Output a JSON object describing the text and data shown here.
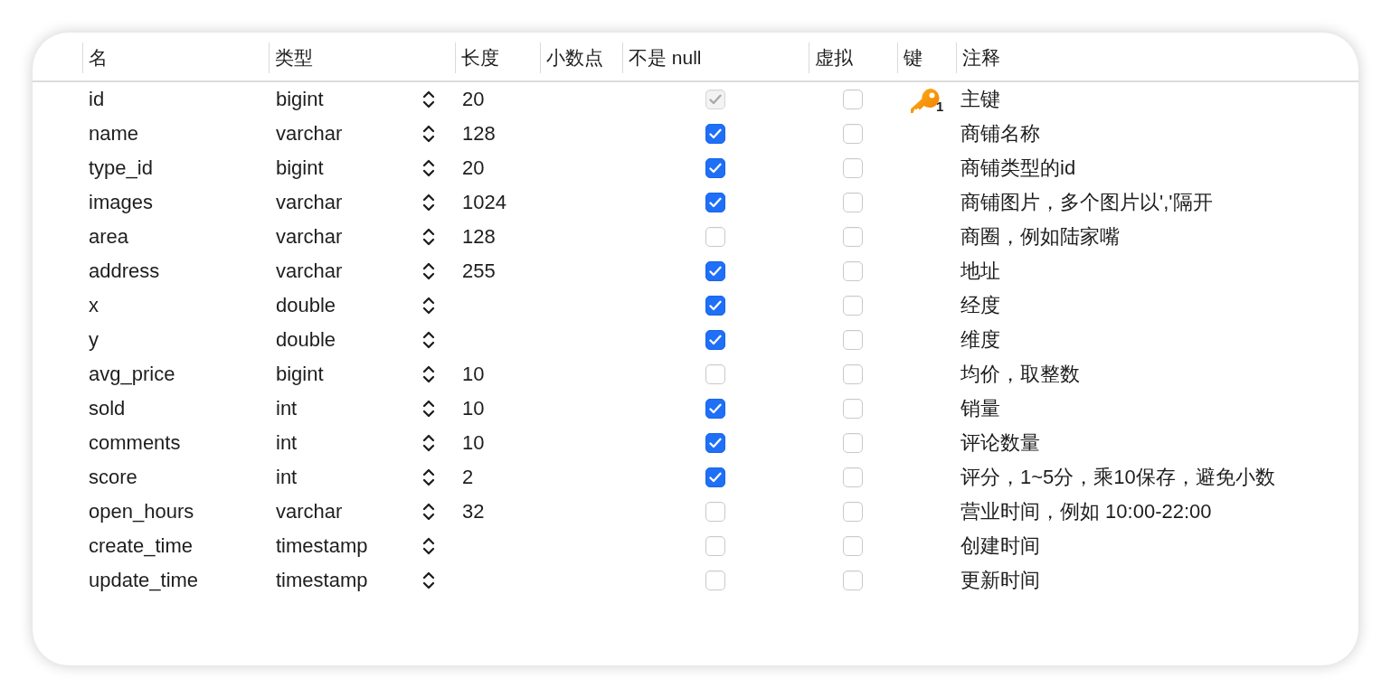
{
  "columns": [
    "名",
    "类型",
    "长度",
    "小数点",
    "不是 null",
    "虚拟",
    "键",
    "注释"
  ],
  "rows": [
    {
      "name": "id",
      "type": "bigint",
      "length": "20",
      "not_null": true,
      "not_null_disabled": true,
      "virtual": false,
      "primary_key": true,
      "key_order": "1",
      "comment": "主键"
    },
    {
      "name": "name",
      "type": "varchar",
      "length": "128",
      "not_null": true,
      "not_null_disabled": false,
      "virtual": false,
      "primary_key": false,
      "comment": "商铺名称"
    },
    {
      "name": "type_id",
      "type": "bigint",
      "length": "20",
      "not_null": true,
      "not_null_disabled": false,
      "virtual": false,
      "primary_key": false,
      "comment": "商铺类型的id"
    },
    {
      "name": "images",
      "type": "varchar",
      "length": "1024",
      "not_null": true,
      "not_null_disabled": false,
      "virtual": false,
      "primary_key": false,
      "comment": "商铺图片，多个图片以','隔开"
    },
    {
      "name": "area",
      "type": "varchar",
      "length": "128",
      "not_null": false,
      "not_null_disabled": false,
      "virtual": false,
      "primary_key": false,
      "comment": "商圈，例如陆家嘴"
    },
    {
      "name": "address",
      "type": "varchar",
      "length": "255",
      "not_null": true,
      "not_null_disabled": false,
      "virtual": false,
      "primary_key": false,
      "comment": "地址"
    },
    {
      "name": "x",
      "type": "double",
      "not_null": true,
      "not_null_disabled": false,
      "virtual": false,
      "primary_key": false,
      "comment": "经度"
    },
    {
      "name": "y",
      "type": "double",
      "not_null": true,
      "not_null_disabled": false,
      "virtual": false,
      "primary_key": false,
      "comment": "维度"
    },
    {
      "name": "avg_price",
      "type": "bigint",
      "length": "10",
      "not_null": false,
      "not_null_disabled": false,
      "virtual": false,
      "primary_key": false,
      "comment": "均价，取整数"
    },
    {
      "name": "sold",
      "type": "int",
      "length": "10",
      "not_null": true,
      "not_null_disabled": false,
      "virtual": false,
      "primary_key": false,
      "comment": "销量"
    },
    {
      "name": "comments",
      "type": "int",
      "length": "10",
      "not_null": true,
      "not_null_disabled": false,
      "virtual": false,
      "primary_key": false,
      "comment": "评论数量"
    },
    {
      "name": "score",
      "type": "int",
      "length": "2",
      "not_null": true,
      "not_null_disabled": false,
      "virtual": false,
      "primary_key": false,
      "comment": "评分，1~5分，乘10保存，避免小数"
    },
    {
      "name": "open_hours",
      "type": "varchar",
      "length": "32",
      "not_null": false,
      "not_null_disabled": false,
      "virtual": false,
      "primary_key": false,
      "comment": "营业时间，例如 10:00-22:00"
    },
    {
      "name": "create_time",
      "type": "timestamp",
      "not_null": false,
      "not_null_disabled": false,
      "virtual": false,
      "primary_key": false,
      "comment": "创建时间"
    },
    {
      "name": "update_time",
      "type": "timestamp",
      "not_null": false,
      "not_null_disabled": false,
      "virtual": false,
      "primary_key": false,
      "comment": "更新时间"
    }
  ]
}
